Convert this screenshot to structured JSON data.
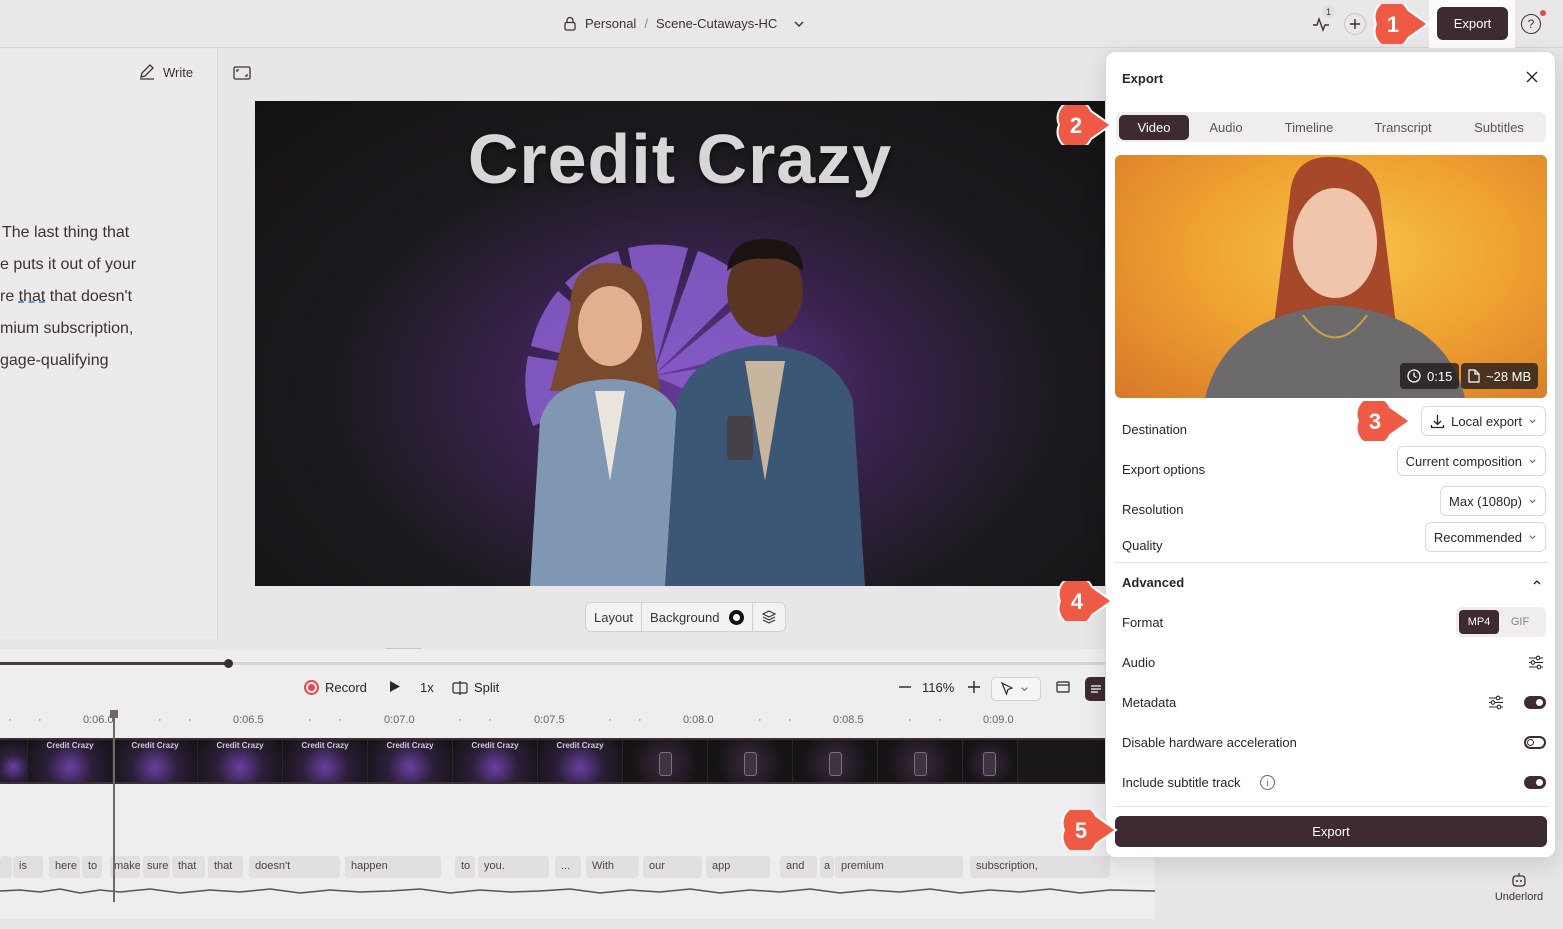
{
  "breadcrumb": {
    "workspace": "Personal",
    "separator": "/",
    "project": "Scene-Cutaways-HC"
  },
  "topbar": {
    "activity_count": "1",
    "export_label": "Export"
  },
  "script": {
    "write_label": "Write",
    "lines": [
      "The last thing that",
      "e puts it out of your",
      "re that that doesn't",
      "mium subscription,",
      "gage-qualifying"
    ]
  },
  "video": {
    "title": "Credit Crazy"
  },
  "canvas_toolbar": {
    "layout_label": "Layout",
    "background_label": "Background"
  },
  "timeline": {
    "record_label": "Record",
    "speed_label": "1x",
    "split_label": "Split",
    "zoom_label": "116%",
    "ruler": [
      "0:06.0",
      "0:06.5",
      "0:07.0",
      "0:07.5",
      "0:08.0",
      "0:08.5",
      "0:09.0"
    ],
    "frame_title": "Credit Crazy",
    "words": [
      "is",
      "here",
      "to",
      "make",
      "sure",
      "that",
      "that",
      "doesn't",
      "happen",
      "to",
      "you.",
      "...",
      "With",
      "our",
      "app",
      "and",
      "a",
      "premium",
      "subscription,"
    ]
  },
  "export_panel": {
    "title": "Export",
    "tabs": [
      "Video",
      "Audio",
      "Timeline",
      "Transcript",
      "Subtitles"
    ],
    "active_tab": "Video",
    "duration": "0:15",
    "size": "~28 MB",
    "destination_label": "Destination",
    "destination_value": "Local export",
    "export_options_label": "Export options",
    "export_options_value": "Current composition",
    "resolution_label": "Resolution",
    "resolution_value": "Max (1080p)",
    "quality_label": "Quality",
    "quality_value": "Recommended",
    "advanced_label": "Advanced",
    "format_label": "Format",
    "format_options": [
      "MP4",
      "GIF"
    ],
    "format_selected": "MP4",
    "audio_label": "Audio",
    "metadata_label": "Metadata",
    "metadata_on": true,
    "hw_accel_label": "Disable hardware acceleration",
    "hw_accel_on": false,
    "subtitle_track_label": "Include subtitle track",
    "subtitle_track_on": true,
    "export_button": "Export"
  },
  "callouts": [
    "1",
    "2",
    "3",
    "4",
    "5"
  ],
  "underlord_label": "Underlord",
  "colors": {
    "accent": "#3d2a33",
    "callout": "#ef5a45",
    "record": "#e5484d"
  }
}
